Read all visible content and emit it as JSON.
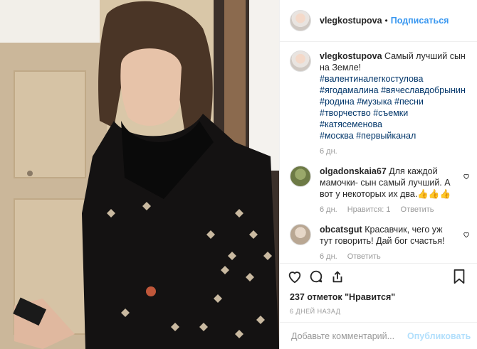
{
  "header": {
    "username": "vlegkostupova",
    "dot": "•",
    "follow_label": "Подписаться"
  },
  "caption": {
    "username": "vlegkostupova",
    "text": "Самый лучший сын на Земле!",
    "hashtags": [
      "#валентиналегкостулова",
      "#ягодамалина",
      "#вячеславдобрынин",
      "#родина",
      "#музыка",
      "#песни",
      "#творчество",
      "#съемки",
      "#катясеменова",
      "#москва",
      "#первыйканал"
    ],
    "time": "6 дн."
  },
  "comments": [
    {
      "username": "olgadonskaia67",
      "text": "Для каждой мамочки- сын самый лучший. А вот у некоторых их два.👍👍👍",
      "time": "6 дн.",
      "likes": "Нравится: 1",
      "reply": "Ответить"
    },
    {
      "username": "obcatsgut",
      "text": "Красавчик, чего уж тут говорить! Дай бог счастья!",
      "time": "6 дн.",
      "reply": "Ответить"
    }
  ],
  "likes_text": "237 отметок \"Нравится\"",
  "date_text": "6 ДНЕЙ НАЗАД",
  "add_comment": {
    "placeholder": "Добавьте комментарий...",
    "publish_label": "Опубликовать"
  },
  "icons": {
    "like": "heart-icon",
    "comment": "comment-icon",
    "share": "share-icon",
    "save": "bookmark-icon",
    "more": "more-icon"
  }
}
